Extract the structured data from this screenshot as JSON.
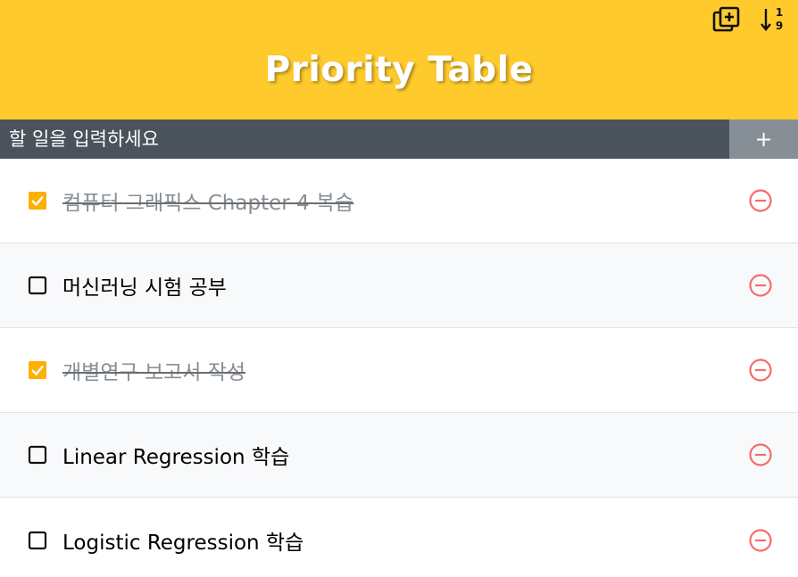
{
  "header": {
    "title": "Priority Table",
    "tools": [
      "add-copy-icon",
      "sort-numeric-icon"
    ]
  },
  "input": {
    "placeholder": "할 일을 입력하세요",
    "add_label": "+"
  },
  "todos": [
    {
      "text": "컴퓨터 그래픽스 Chapter 4 복습",
      "checked": true
    },
    {
      "text": "머신러닝 시험 공부",
      "checked": false
    },
    {
      "text": "개별연구 보고서 작성",
      "checked": true
    },
    {
      "text": "Linear Regression 학습",
      "checked": false
    },
    {
      "text": "Logistic Regression 학습",
      "checked": false
    }
  ],
  "colors": {
    "header": "#ffca2c",
    "input_bar": "#4a525b",
    "add_button": "#868e96",
    "checked": "#fcb000",
    "remove": "#f56c6c"
  }
}
